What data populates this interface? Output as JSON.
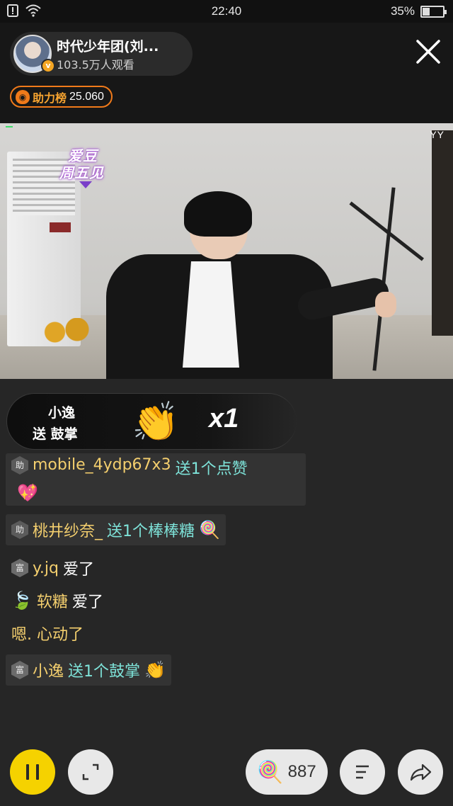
{
  "status_bar": {
    "time": "22:40",
    "battery": "35%",
    "battery_level": 0.35,
    "icons": [
      "notification-icon",
      "wifi-icon",
      "battery-icon"
    ]
  },
  "anchor": {
    "name": "时代少年团(刘...",
    "viewers": "103.5万人观看",
    "verified_icon": "v-badge-icon"
  },
  "rank": {
    "label": "助力榜",
    "value": "25.060"
  },
  "video": {
    "logo_line1": "爱豆",
    "logo_line2": "周五见",
    "watermark": "YY"
  },
  "gift_banner": {
    "sender": "小逸",
    "action": "送 鼓掌",
    "count": "x1",
    "icon": "clapping-hands-icon"
  },
  "chat": [
    {
      "badge": "助",
      "user": "mobile_4ydp67x3",
      "text": "送1个点赞",
      "emoji": "💖",
      "style": "gift"
    },
    {
      "badge": "助",
      "user": "桃井纱奈_",
      "text": "送1个棒棒糖",
      "emoji": "🍭",
      "style": "gift"
    },
    {
      "badge": "富",
      "user": "y.jq",
      "text": "爱了",
      "style": "plain"
    },
    {
      "badge": "",
      "user": "软糖",
      "text": "爱了",
      "emoji": "🍃",
      "style": "plain"
    },
    {
      "badge": "",
      "user": "",
      "text": "嗯. 心动了",
      "style": "plain"
    },
    {
      "badge": "富",
      "user": "小逸",
      "text": "送1个鼓掌",
      "emoji": "👏",
      "style": "gift"
    }
  ],
  "bottom_bar": {
    "gift_count": "887",
    "gift_icon": "lollipop-icon"
  },
  "colors": {
    "accent_yellow": "#f5d200",
    "username": "#f4cf6e",
    "gift_text": "#7ee3d9",
    "rank_orange": "#f07a1a"
  }
}
